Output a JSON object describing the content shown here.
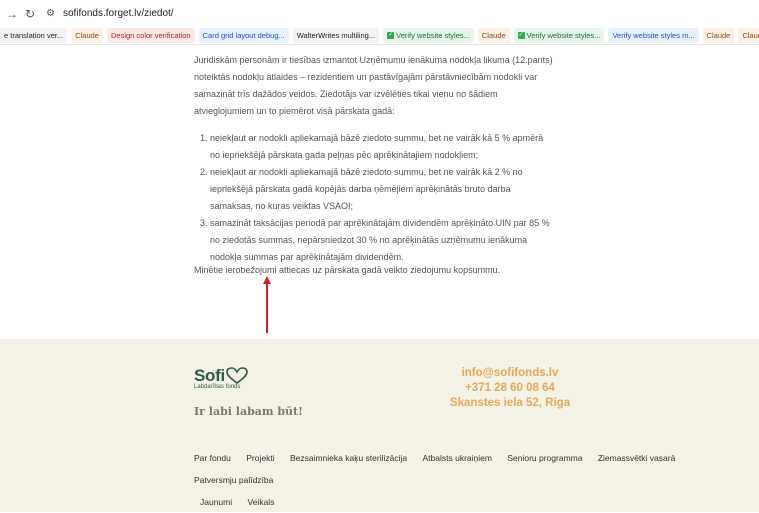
{
  "browser": {
    "url": "sofifonds.forget.lv/ziedot/",
    "bookmarks": [
      {
        "label": "e translation ver...",
        "style": "plain"
      },
      {
        "label": "Claude",
        "style": "orange"
      },
      {
        "label": "Design color verification",
        "style": "red"
      },
      {
        "label": "Card grid layout debug...",
        "style": "blue"
      },
      {
        "label": "WalterWrites multiling...",
        "style": "plain"
      },
      {
        "label": "Verify website styles...",
        "style": "green"
      },
      {
        "label": "Claude",
        "style": "orange"
      },
      {
        "label": "Verify website styles...",
        "style": "green"
      },
      {
        "label": "Verify website styles m...",
        "style": "blue"
      },
      {
        "label": "Claude",
        "style": "orange"
      },
      {
        "label": "Claude",
        "style": "orange"
      },
      {
        "label": "Claude",
        "style": "orange"
      }
    ]
  },
  "content": {
    "intro": "Juridiskām personām ir tiesības izmantot Uzņēmumu ienākuma nodokļa likuma (12.pants) noteiktās nodokļu atlaides – rezidentiem un pastāvīgajām pārstāvniecībām nodokli var samazināt trīs dažādos veidos. Ziedotājs var izvēlēties tikai vienu no šādiem atvieglojumiem un to piemērot visā pārskata gadā:",
    "items": [
      "neiekļaut ar nodokli apliekamajā bāzē ziedoto summu, bet ne vairāk kā 5 % apmērā no iepriekšējā pārskata gada peļņas pēc aprēķinātajiem nodokļiem;",
      "neiekļaut ar nodokli apliekamajā bāzē ziedoto summu, bet ne vairāk kā 2 % no iepriekšējā pārskata gadā kopējās darba ņēmējiem aprēķinātās bruto darba samaksas, no kuras veiktas VSAOI;",
      "samazināt taksācijas periodā par aprēķinātajām dividendēm aprēķināto UIN par 85 % no ziedotās summas, nepārsniedzot 30 % no aprēķinātās uzņēmumu ienākuma nodokļa summas par aprēķinātajām dividendēm."
    ],
    "note": "Minētie ierobežojumi attiecas uz pārskata gadā veikto ziedojumu kopsummu."
  },
  "footer": {
    "logo_word": "Sofi",
    "logo_sub": "Labdarības fonds",
    "tagline": "Ir labi labam būt!",
    "email": "info@sofifonds.lv",
    "phone": "+371 28 60 08 64",
    "address": "Skanstes iela 52, Rīga",
    "nav_row1": [
      "Par fondu",
      "Projekti",
      "Bezsaimnieka kaķu sterilizācija",
      "Atbalsts ukraiņiem",
      "Senioru programma",
      "Ziemassvētki vasarā",
      "Patversmju palīdzība"
    ],
    "nav_row2": [
      "Jaunumi",
      "Veikals"
    ]
  },
  "colors": {
    "accent": "#e6a95a",
    "logo": "#2f5a46",
    "footer_bg": "#f4f2e6",
    "annotation_arrow": "#d0202a"
  }
}
